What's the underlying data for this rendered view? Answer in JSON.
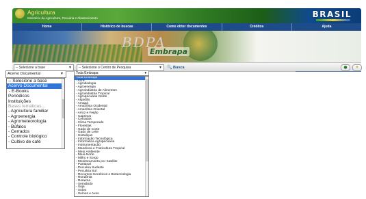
{
  "header": {
    "ministry": "Agricultura",
    "subtitle": "Ministério da Agricultura, Pecuária e Abastecimento",
    "brasil": "BRASIL"
  },
  "nav": [
    "Home",
    "Histórico de buscas",
    "Como obter documentos",
    "Créditos",
    "Ajuda"
  ],
  "banner": {
    "bdpa": "BDPA",
    "embrapa": "Embrapa"
  },
  "search": {
    "base_select": "-- Selecione a base",
    "centro_select": "-- Selecione o Centro de Pesquisa",
    "busca_label": "Busca"
  },
  "acervo": {
    "selected": "Acervo Documental",
    "options": [
      "-- Selecione a base",
      "Acervo Documental",
      "- E-Books",
      "Periódicos",
      "Instituições",
      "Bases temáticas...",
      "- Agricultura familiar",
      "- Agroenergia",
      "- Agrometeorologia",
      "- Búfalos",
      "- Cerrados",
      "- Controle biológico",
      "- Cultivo de café"
    ]
  },
  "centro": {
    "selected": "Toda Embrapa",
    "options": [
      "Toda Embrapa",
      "- Acre",
      "- Agrobiologia",
      "- Agroenergia",
      "- Agroindústria de Alimentos",
      "- Agroindústria Tropical",
      "- Agropecuária Oeste",
      "- Algodão",
      "- Amapá",
      "- Amazônia Ocidental",
      "- Amazônia Oriental",
      "- Arroz e Feijão",
      "- Caprinos",
      "- Cerrados",
      "- Clima Temperado",
      "- Florestas",
      "- Gado de Corte",
      "- Gado de Leite",
      "- Hortaliças",
      "- Informação Tecnológica",
      "- Informática Agropecuária",
      "- Instrumentação",
      "- Mandioca e Fruticultura Tropical",
      "- Meio Ambiente",
      "- Meio-Norte",
      "- Milho e Sorgo",
      "- Monitoramento por Satélite",
      "- Pantanal",
      "- Pecuária Sudeste",
      "- Pecuária Sul",
      "- Recursos Genéticos e Biotecnologia",
      "- Rondônia",
      "- Roraima",
      "- Semiárido",
      "- Soja",
      "- Solos",
      "- Suínos e Aves"
    ]
  },
  "colors": {
    "nav_blue": "#1e4c8a",
    "selection_blue": "#3375d7",
    "gov_green": "#3a8a2a"
  }
}
